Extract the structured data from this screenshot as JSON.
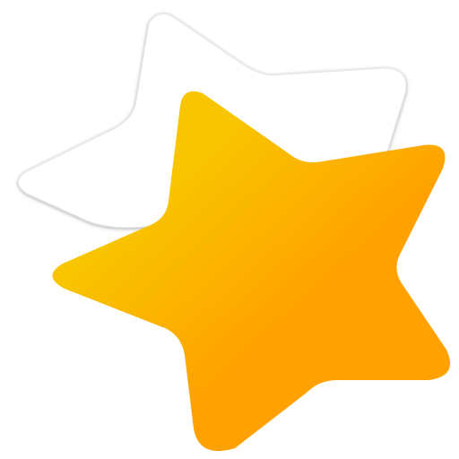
{
  "graphic": {
    "icon": "star-pair-icon",
    "back_star_icon": "star-outline-icon",
    "front_star_icon": "star-filled-icon",
    "colors": {
      "background": "#ffffff",
      "back_star_fill": "#ffffff",
      "back_star_shadow": "#cfcfcf",
      "front_star_gradient_start": "#f9c400",
      "front_star_gradient_end": "#ffa100"
    }
  }
}
